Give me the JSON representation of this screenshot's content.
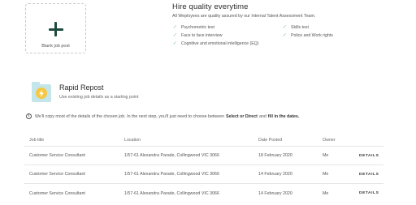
{
  "blank_post": {
    "label": "Blank job post"
  },
  "hire": {
    "title": "Hire quality everytime",
    "subtitle": "All Weployees are quality assured by our Internal Talent Assessment Team.",
    "checks": [
      "Psychometric test",
      "Skills test",
      "Face to face interview",
      "Police and Work rights",
      "Cognitive and emotional intelligence (EQ)"
    ]
  },
  "rapid": {
    "title": "Rapid Repost",
    "subtitle": "Use existing job details as a starting point"
  },
  "info": {
    "text_before": "We'll copy most of the details of the chosen job. In the next step, you'll just need to choose between",
    "select_or_direct": "Select or Direct",
    "and": "and",
    "fill_in_dates": "fill in the dates."
  },
  "table": {
    "headers": {
      "job_title": "Job title",
      "location": "Location",
      "date_posted": "Date Posted",
      "owner": "Owner"
    },
    "details_label": "DETAILS",
    "rows": [
      {
        "job_title": "Customer Service Consultant",
        "location": "1/57-61 Alexandra Parade, Collingwood VIC 3066",
        "date_posted": "18 February 2020",
        "owner": "Me"
      },
      {
        "job_title": "Customer Service Consultant",
        "location": "1/57-61 Alexandra Parade, Collingwood VIC 3066",
        "date_posted": "14 February 2020",
        "owner": "Me"
      },
      {
        "job_title": "Customer Service Consultant",
        "location": "1/57-61 Alexandra Parade, Collingwood VIC 3066",
        "date_posted": "14 February 2020",
        "owner": "Me"
      }
    ]
  },
  "colors": {
    "accent_dark_green": "#1f4a3e",
    "check_green": "#8fc6a4",
    "rapid_icon_bg": "#c4e6ea",
    "bolt_yellow": "#f6c744"
  },
  "icons": {
    "plus": "plus-icon",
    "check": "check-icon",
    "bolt": "lightning-bolt-icon",
    "info": "info-icon"
  }
}
